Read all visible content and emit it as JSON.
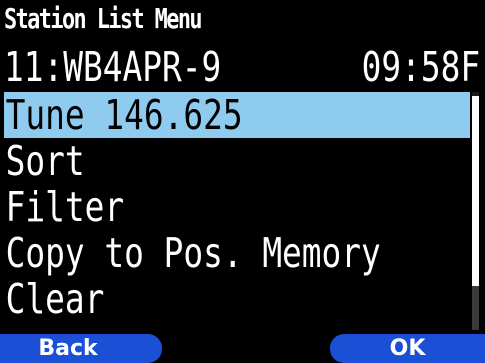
{
  "header": {
    "title": "Station List Menu",
    "station_entry": "11:WB4APR-9",
    "status_time": "09:58F"
  },
  "menu": {
    "items": [
      {
        "label": "Tune 146.625",
        "selected": true
      },
      {
        "label": "Sort",
        "selected": false
      },
      {
        "label": "Filter",
        "selected": false
      },
      {
        "label": "Copy to Pos. Memory",
        "selected": false
      },
      {
        "label": "Clear",
        "selected": false
      }
    ]
  },
  "softkeys": {
    "left_label": "Back",
    "right_label": "OK"
  },
  "colors": {
    "background": "#000000",
    "text": "#ffffff",
    "selection": "#8ecbef",
    "softkey": "#1a4fd6"
  }
}
